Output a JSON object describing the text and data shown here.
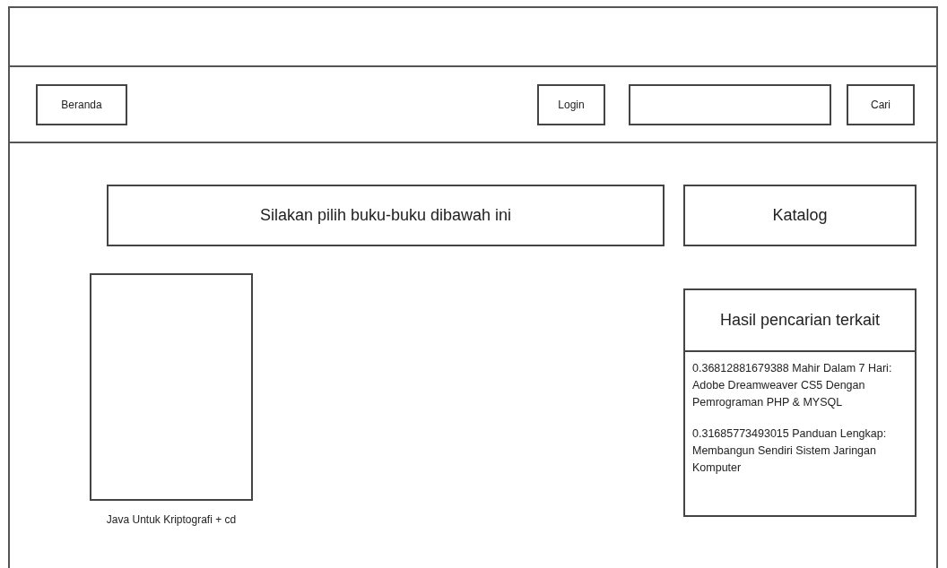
{
  "nav": {
    "home_button": "Beranda",
    "login_button": "Login",
    "search_button": "Cari"
  },
  "banner": "Silakan pilih buku-buku dibawah ini",
  "catalog_button": "Katalog",
  "books": [
    {
      "title": "Java Untuk Kriptografi + cd"
    }
  ],
  "related": {
    "title": "Hasil pencarian terkait",
    "results": [
      "0.36812881679388 Mahir Dalam 7 Hari: Adobe Dreamweaver CS5 Dengan Pemrograman PHP & MYSQL",
      "0.31685773493015 Panduan Lengkap: Membangun Sendiri Sistem Jaringan Komputer"
    ]
  }
}
